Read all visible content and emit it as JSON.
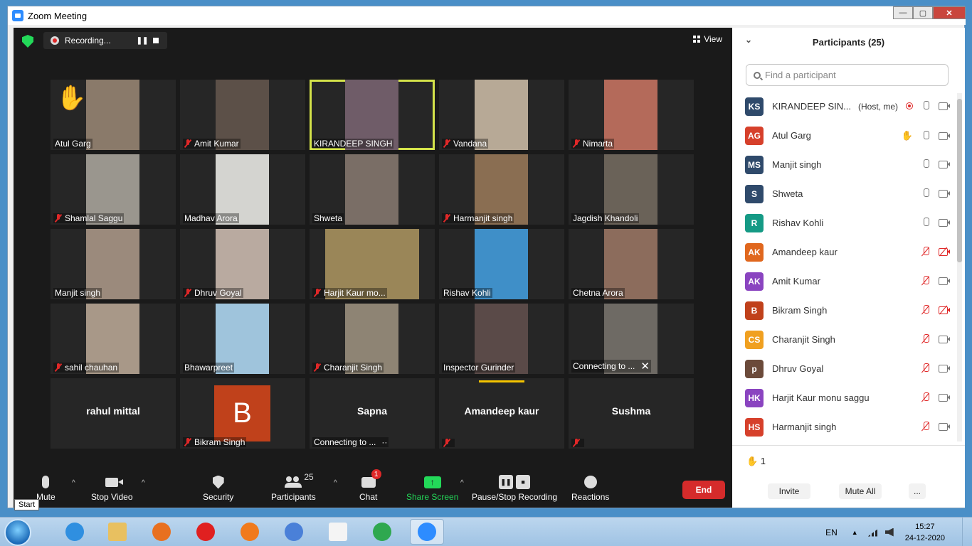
{
  "window": {
    "title": "Zoom Meeting",
    "min": "—",
    "max": "▢",
    "close": "✕"
  },
  "recording": {
    "label": "Recording...",
    "pause": "❚❚"
  },
  "view": {
    "label": "View"
  },
  "tiles": [
    {
      "name": "Atul Garg",
      "muted": false,
      "hand": "✋",
      "photo": "#8a7a6a"
    },
    {
      "name": "Amit Kumar",
      "muted": true,
      "photo": "#5c5048"
    },
    {
      "name": "KIRANDEEP SINGH",
      "muted": false,
      "active": true,
      "photo": "#6f5c68"
    },
    {
      "name": "Vandana",
      "muted": true,
      "photo": "#b7a996"
    },
    {
      "name": "Nimarta",
      "muted": true,
      "photo": "#b46a5a"
    },
    {
      "name": "Shamlal Saggu",
      "muted": true,
      "photo": "#9a968e"
    },
    {
      "name": "Madhav Arora",
      "muted": false,
      "photo": "#d4d4d0"
    },
    {
      "name": "Shweta",
      "muted": false,
      "photo": "#7a6e66"
    },
    {
      "name": "Harmanjit singh",
      "muted": true,
      "photo": "#8a6e52"
    },
    {
      "name": "Jagdish Khandoli",
      "muted": false,
      "photo": "#6a6258"
    },
    {
      "name": "Manjit singh",
      "muted": false,
      "photo": "#9b8a7c"
    },
    {
      "name": "Dhruv Goyal",
      "muted": true,
      "photo": "#b9aaa0"
    },
    {
      "name": "Harjit Kaur mo...",
      "muted": true,
      "photo": "#9a8658",
      "wide": true
    },
    {
      "name": "Rishav Kohli",
      "muted": false,
      "photo": "#3f8fc8"
    },
    {
      "name": "Chetna Arora",
      "muted": false,
      "photo": "#8c6c5c"
    },
    {
      "name": "sahil chauhan",
      "muted": true,
      "photo": "#a89888"
    },
    {
      "name": "Bhawarpreet",
      "muted": false,
      "photo": "#9fc4dc"
    },
    {
      "name": "Charanjit Singh",
      "muted": true,
      "photo": "#8e8474"
    },
    {
      "name": "Inspector Gurinder",
      "muted": false,
      "photo": "#5a4a48"
    },
    {
      "name": "Connecting to ...",
      "muted": false,
      "photo": "#6e6a64",
      "closable": true,
      "close": "✕"
    },
    {
      "bigname": "rahul mittal",
      "name": ""
    },
    {
      "name": "Bikram Singh",
      "muted": true,
      "avatar": "B"
    },
    {
      "bigname": "Sapna",
      "name": "Connecting to ...",
      "dots": "··"
    },
    {
      "bigname": "Amandeep kaur",
      "name": "",
      "muted": true
    },
    {
      "bigname": "Sushma",
      "name": "",
      "muted": true
    }
  ],
  "toolbar": {
    "mute": "Mute",
    "stop_video": "Stop Video",
    "security": "Security",
    "participants": "Participants",
    "participants_count": "25",
    "chat": "Chat",
    "chat_badge": "1",
    "share_screen": "Share Screen",
    "pause_stop_recording": "Pause/Stop Recording",
    "reactions": "Reactions",
    "end": "End",
    "caret": "^"
  },
  "panel": {
    "title": "Participants (25)",
    "chevron": "⌄",
    "search_placeholder": "Find a participant",
    "participants": [
      {
        "initials": "KS",
        "name": "KIRANDEEP SIN...",
        "note": "(Host, me)",
        "color": "#2f4a6b",
        "rec": true,
        "mic": "on",
        "cam": "on"
      },
      {
        "initials": "AG",
        "name": "Atul Garg",
        "color": "#d6402b",
        "hand": "✋",
        "mic": "on",
        "cam": "on"
      },
      {
        "initials": "MS",
        "name": "Manjit singh",
        "color": "#2f4a6b",
        "mic": "on",
        "cam": "on"
      },
      {
        "initials": "S",
        "name": "Shweta",
        "color": "#2f4a6b",
        "mic": "on",
        "cam": "on"
      },
      {
        "initials": "R",
        "name": "Rishav Kohli",
        "color": "#159a85",
        "mic": "on",
        "cam": "on"
      },
      {
        "initials": "AK",
        "name": "Amandeep kaur",
        "color": "#e0671e",
        "mic": "off",
        "cam": "off"
      },
      {
        "initials": "AK",
        "name": "Amit Kumar",
        "color": "#8a44c0",
        "mic": "off",
        "cam": "on"
      },
      {
        "initials": "B",
        "name": "Bikram Singh",
        "color": "#c0411b",
        "mic": "off",
        "cam": "off"
      },
      {
        "initials": "CS",
        "name": "Charanjit Singh",
        "color": "#f0a020",
        "mic": "off",
        "cam": "on"
      },
      {
        "initials": "p",
        "name": "Dhruv Goyal",
        "color": "#6b4a3a",
        "mic": "off",
        "cam": "on"
      },
      {
        "initials": "HK",
        "name": "Harjit Kaur monu saggu",
        "color": "#8a44c0",
        "mic": "off",
        "cam": "on"
      },
      {
        "initials": "HS",
        "name": "Harmanjit singh",
        "color": "#d6402b",
        "mic": "off",
        "cam": "on"
      }
    ],
    "raised_hands": "✋ 1",
    "invite": "Invite",
    "mute_all": "Mute All",
    "more": "..."
  },
  "tooltip": "Start",
  "taskbar": {
    "apps": [
      {
        "name": "internet-explorer",
        "color": "#2f8fe0"
      },
      {
        "name": "file-explorer",
        "color": "#e8c060"
      },
      {
        "name": "media-player",
        "color": "#e87020"
      },
      {
        "name": "opera",
        "color": "#e02020"
      },
      {
        "name": "firefox",
        "color": "#f07a1c"
      },
      {
        "name": "chromium",
        "color": "#4a80d8"
      },
      {
        "name": "blank-document",
        "color": "#f4f4f4"
      },
      {
        "name": "chrome",
        "color": "#2fa84f"
      },
      {
        "name": "zoom",
        "color": "#2d8cff"
      }
    ],
    "lang": "EN",
    "tray_up": "▲",
    "time": "15:27",
    "date": "24-12-2020"
  }
}
